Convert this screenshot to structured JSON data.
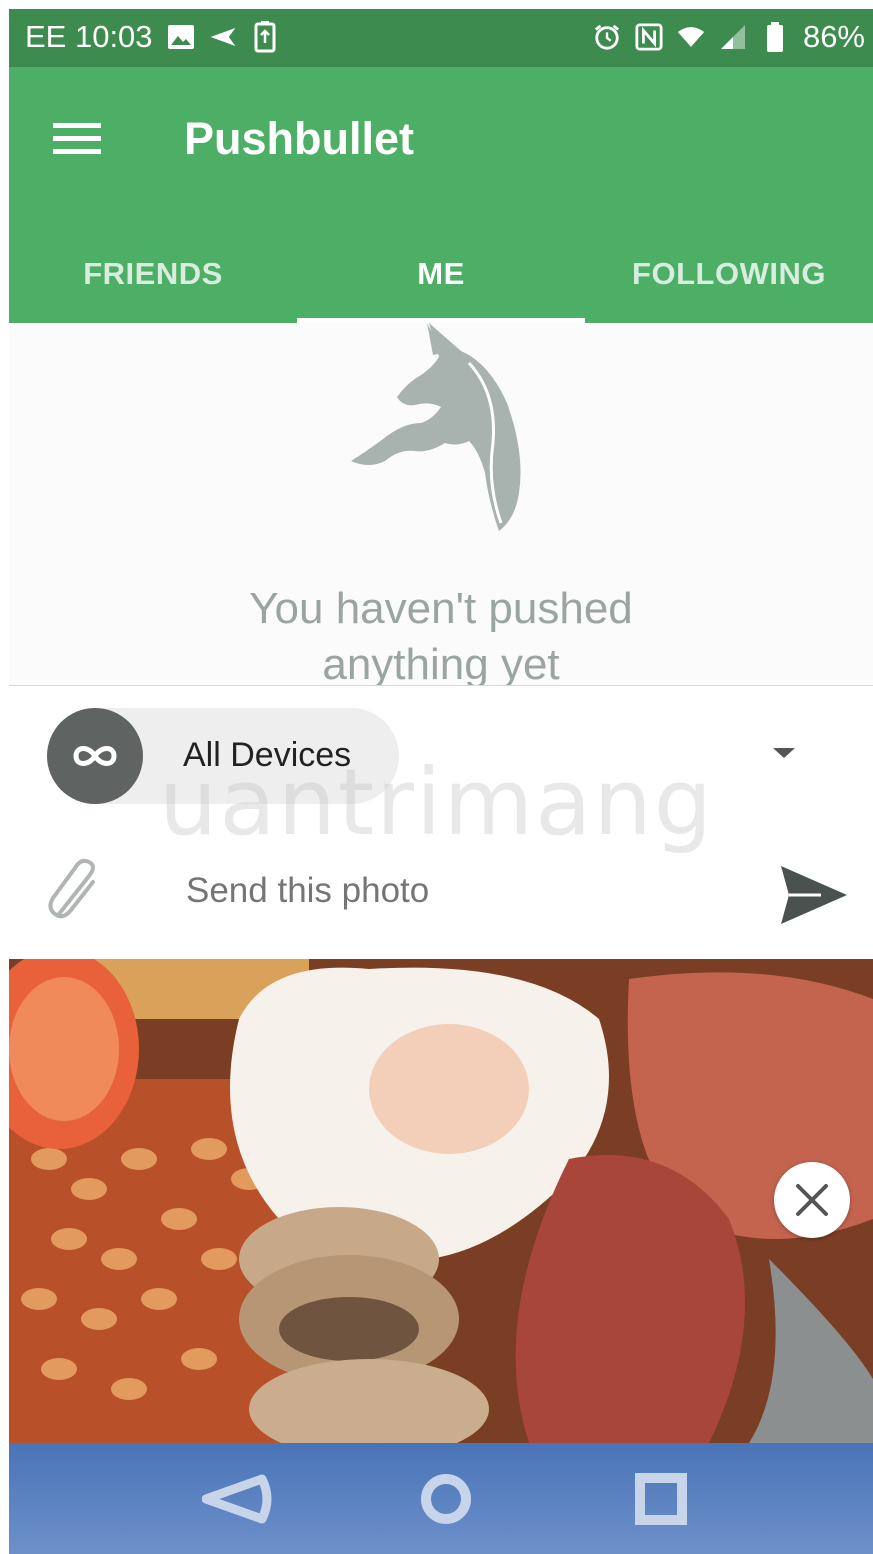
{
  "status_bar": {
    "carrier_time": "EE 10:03",
    "left_icons": [
      "image-icon",
      "send-icon",
      "battery-saver-icon"
    ],
    "right_icons": [
      "alarm-icon",
      "nfc-icon",
      "wifi-icon",
      "signal-icon",
      "battery-icon"
    ],
    "battery": "86%"
  },
  "app_bar": {
    "title": "Pushbullet",
    "menu_icon": "hamburger-menu-icon",
    "color": "#4daf66"
  },
  "tabs": [
    {
      "label": "FRIENDS",
      "active": false
    },
    {
      "label": "ME",
      "active": true
    },
    {
      "label": "FOLLOWING",
      "active": false
    }
  ],
  "empty_state": {
    "icon": "unicorn-icon",
    "message_line1": "You haven't pushed",
    "message_line2": "anything yet"
  },
  "device_selector": {
    "icon": "infinity-icon",
    "label": "All Devices",
    "dropdown_icon": "dropdown-arrow-icon"
  },
  "compose": {
    "attach_icon": "paperclip-icon",
    "placeholder": "Send this photo",
    "send_icon": "send-icon"
  },
  "photo": {
    "close_icon": "close-icon"
  },
  "watermark": "uantrimang",
  "nav_bar": {
    "buttons": [
      "back-icon",
      "home-icon",
      "recents-icon"
    ]
  }
}
